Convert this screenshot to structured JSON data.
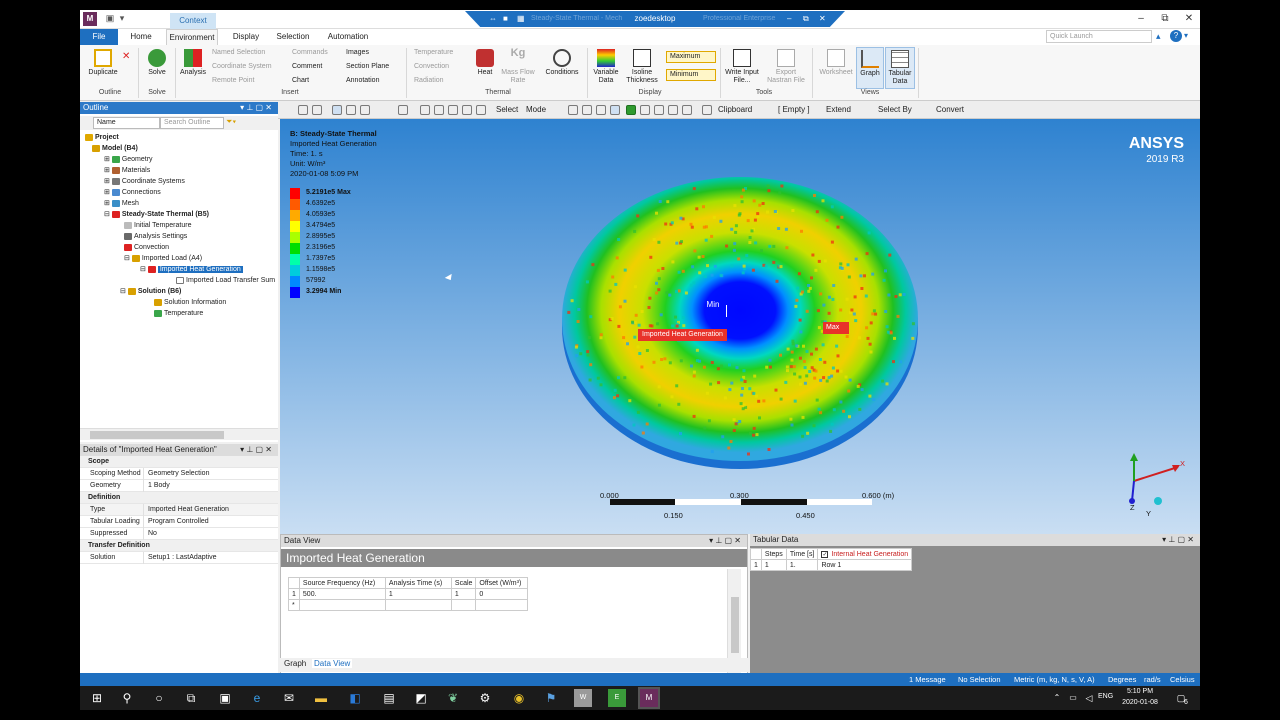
{
  "window": {
    "title": "zoedesktop",
    "context_tab": "Context",
    "title_blurred_left": "Steady-State Thermal - Mech",
    "title_blurred_right": "Professional Enterprise"
  },
  "menu": {
    "file": "File",
    "tabs": [
      "Home",
      "Environment",
      "Display",
      "Selection",
      "Automation"
    ],
    "quick_launch_placeholder": "Quick Launch"
  },
  "ribbon": {
    "outline": {
      "duplicate": "Duplicate",
      "group": "Outline"
    },
    "solve": {
      "solve": "Solve",
      "group": "Solve"
    },
    "insert": {
      "analysis": "Analysis",
      "named_selection": "Named Selection",
      "coordinate_system": "Coordinate System",
      "remote_point": "Remote Point",
      "commands": "Commands",
      "comment": "Comment",
      "chart": "Chart",
      "images": "Images",
      "section_plane": "Section Plane",
      "annotation": "Annotation",
      "group": "Insert"
    },
    "thermal": {
      "temperature": "Temperature",
      "convection": "Convection",
      "radiation": "Radiation",
      "heat": "Heat",
      "mass_flow_rate": "Mass Flow Rate",
      "conditions": "Conditions",
      "group": "Thermal"
    },
    "display": {
      "variable_data": "Variable Data",
      "isoline_thickness": "Isoline Thickness",
      "maximum": "Maximum",
      "minimum": "Minimum",
      "group": "Display"
    },
    "tools": {
      "write_input_file": "Write Input File...",
      "export_nastran": "Export Nastran File",
      "group": "Tools"
    },
    "views": {
      "worksheet": "Worksheet",
      "graph": "Graph",
      "tabular_data": "Tabular Data",
      "group": "Views"
    }
  },
  "toolbar": {
    "select": "Select",
    "mode": "Mode",
    "clipboard": "Clipboard",
    "empty": "[ Empty ]",
    "extend": "Extend",
    "select_by": "Select By",
    "convert": "Convert"
  },
  "outline": {
    "title": "Outline",
    "name_col": "Name",
    "search_placeholder": "Search Outline",
    "tree": {
      "project": "Project",
      "model": "Model (B4)",
      "geometry": "Geometry",
      "materials": "Materials",
      "coordinate_systems": "Coordinate Systems",
      "connections": "Connections",
      "mesh": "Mesh",
      "steady_state": "Steady-State Thermal (B5)",
      "initial_temperature": "Initial Temperature",
      "analysis_settings": "Analysis Settings",
      "convection": "Convection",
      "imported_load": "Imported Load (A4)",
      "imported_heat_generation": "Imported Heat Generation",
      "imported_load_transfer": "Imported Load Transfer Sum",
      "solution": "Solution (B6)",
      "solution_information": "Solution Information",
      "temperature": "Temperature"
    }
  },
  "details": {
    "title": "Details of \"Imported Heat Generation\"",
    "sections": {
      "scope": "Scope",
      "definition": "Definition",
      "transfer_definition": "Transfer Definition"
    },
    "rows": {
      "scoping_method": {
        "key": "Scoping Method",
        "value": "Geometry Selection"
      },
      "geometry": {
        "key": "Geometry",
        "value": "1 Body"
      },
      "type": {
        "key": "Type",
        "value": "Imported Heat Generation"
      },
      "tabular_loading": {
        "key": "Tabular Loading",
        "value": "Program Controlled"
      },
      "suppressed": {
        "key": "Suppressed",
        "value": "No"
      },
      "solution": {
        "key": "Solution",
        "value": "Setup1 : LastAdaptive"
      }
    }
  },
  "viewport": {
    "title": "B: Steady-State Thermal",
    "subtitle": "Imported Heat Generation",
    "time": "Time: 1. s",
    "unit": "Unit: W/m³",
    "date": "2020-01-08 5:09 PM",
    "brand": "ANSYS",
    "version": "2019 R3",
    "legend": [
      {
        "label": "5.2191e5 Max",
        "color": "#ff0000",
        "bold": true
      },
      {
        "label": "4.6392e5",
        "color": "#ff5a00",
        "bold": false
      },
      {
        "label": "4.0593e5",
        "color": "#ffaa00",
        "bold": false
      },
      {
        "label": "3.4794e5",
        "color": "#ffff00",
        "bold": false
      },
      {
        "label": "2.8995e5",
        "color": "#aaff00",
        "bold": false
      },
      {
        "label": "2.3196e5",
        "color": "#00dd00",
        "bold": false
      },
      {
        "label": "1.7397e5",
        "color": "#00ffaa",
        "bold": false
      },
      {
        "label": "1.1598e5",
        "color": "#00ccdd",
        "bold": false
      },
      {
        "label": "57992",
        "color": "#0088ff",
        "bold": false
      },
      {
        "label": "3.2994 Min",
        "color": "#0000ff",
        "bold": true
      }
    ],
    "min_label": "Min",
    "max_label": "Max",
    "probe_label": "Imported Heat Generation",
    "scale": {
      "t0": "0.000",
      "t1": "0.150",
      "t2": "0.300",
      "t3": "0.450",
      "t4": "0.600 (m)"
    },
    "axes": {
      "x": "X",
      "y": "Y",
      "z": "Z"
    }
  },
  "dataview": {
    "title": "Data View",
    "heading": "Imported Heat Generation",
    "columns": [
      "Source Frequency (Hz)",
      "Analysis Time (s)",
      "Scale",
      "Offset (W/m³)"
    ],
    "rows": [
      {
        "index": "1",
        "cells": [
          "500.",
          "1",
          "1",
          "0"
        ]
      }
    ],
    "new_row_marker": "*",
    "tabs": [
      "Graph",
      "Data View"
    ]
  },
  "tabular": {
    "title": "Tabular Data",
    "columns": [
      "Steps",
      "Time [s]",
      "Internal Heat Generation"
    ],
    "rows": [
      {
        "index": "1",
        "cells": [
          "1",
          "1.",
          "Row 1"
        ]
      }
    ]
  },
  "status": {
    "messages": "1 Message",
    "selection": "No Selection",
    "units": "Metric (m, kg, N, s, V, A)",
    "angle": "Degrees",
    "rate": "rad/s",
    "temp": "Celsius"
  },
  "taskbar": {
    "language": "ENG",
    "time": "5:10 PM",
    "date": "2020-01-08",
    "notifications": "6"
  },
  "colors": {
    "accent": "#1e6fc0",
    "selection": "#1e6fc0",
    "probe": "#e8322a"
  }
}
